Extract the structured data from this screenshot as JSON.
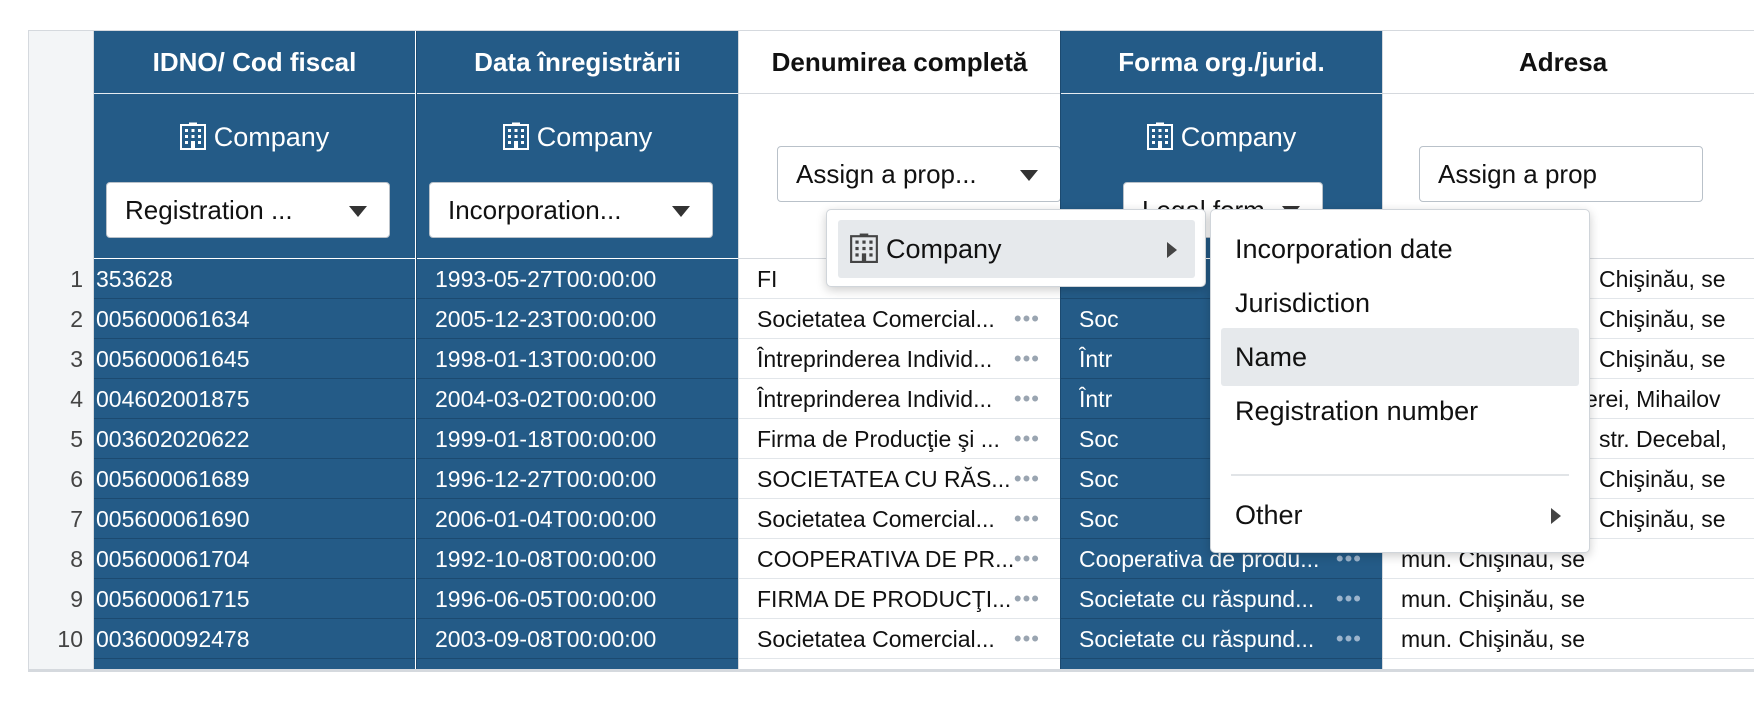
{
  "row_numbers": [
    "1",
    "2",
    "3",
    "4",
    "5",
    "6",
    "7",
    "8",
    "9",
    "10"
  ],
  "columns": [
    {
      "title": "IDNO/ Cod fiscal",
      "type_label": "Company",
      "property_label": "Registration ...",
      "cells": [
        "353628",
        "005600061634",
        "005600061645",
        "004602001875",
        "003602020622",
        "005600061689",
        "005600061690",
        "005600061704",
        "005600061715",
        "003600092478"
      ]
    },
    {
      "title": "Data înregistrării",
      "type_label": "Company",
      "property_label": "Incorporation...",
      "cells": [
        "1993-05-27T00:00:00",
        "2005-12-23T00:00:00",
        "1998-01-13T00:00:00",
        "2004-03-02T00:00:00",
        "1999-01-18T00:00:00",
        "1996-12-27T00:00:00",
        "2006-01-04T00:00:00",
        "1992-10-08T00:00:00",
        "1996-06-05T00:00:00",
        "2003-09-08T00:00:00"
      ]
    },
    {
      "title": "Denumirea completă",
      "assign_label": "Assign a prop...",
      "cells": [
        "FI",
        "Societatea Comercial...",
        "Întreprinderea Individ...",
        "Întreprinderea Individ...",
        "Firma de Producţie şi ...",
        "SOCIETATEA CU RĂS...",
        "Societatea Comercial...",
        "COOPERATIVA DE PR...",
        "FIRMA DE PRODUCŢI...",
        "Societatea Comercial..."
      ],
      "dots": "•••"
    },
    {
      "title": "Forma org./jurid.",
      "type_label": "Company",
      "property_label": "Legal form",
      "cells": [
        "",
        "Soc",
        "Într",
        "Într",
        "Soc",
        "Soc",
        "Soc",
        "Cooperativa de produ...",
        "Societate cu răspund...",
        "Societate cu răspund..."
      ],
      "dots": "•••"
    },
    {
      "title": "Adresa",
      "assign_label": "Assign a prop",
      "cells": [
        "Chişinău, se",
        "Chişinău, se",
        "Chişinău, se",
        "erei, Mihailov",
        "str. Decebal,",
        "Chişinău, se",
        "Chişinău, se",
        "mun. Chişinău, se",
        "mun. Chişinău, se",
        "mun. Chişinău, se"
      ]
    }
  ],
  "menu_type": {
    "label": "Company"
  },
  "menu_props": {
    "items": [
      "Incorporation date",
      "Jurisdiction",
      "Name",
      "Registration number"
    ],
    "highlighted": "Name",
    "other_label": "Other"
  },
  "colors": {
    "selected_column": "#245b87",
    "menu_highlight": "#e6e9ec"
  }
}
